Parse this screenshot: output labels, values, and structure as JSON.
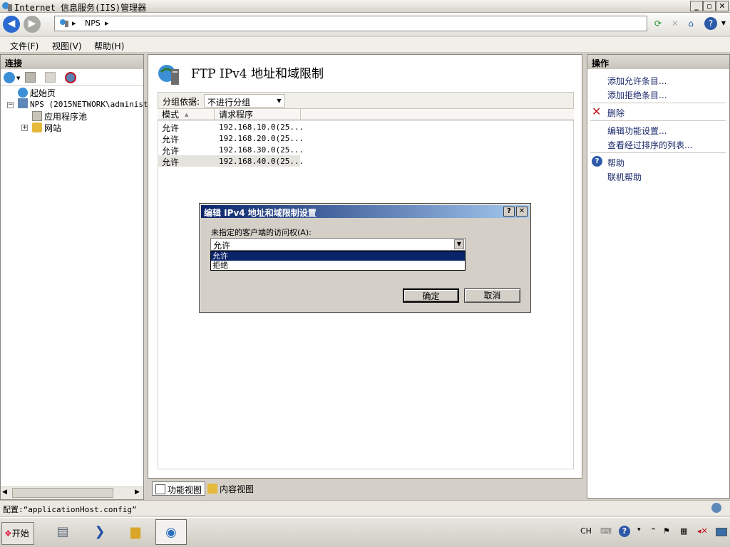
{
  "window": {
    "title": "Internet 信息服务(IIS)管理器",
    "controls": {
      "minimize": "_",
      "restore": "▫",
      "close": "✕"
    }
  },
  "address": {
    "crumbs": [
      "NPS",
      "▸"
    ],
    "separator": "▸",
    "back_icon": "back-arrow-icon",
    "forward_icon": "forward-arrow-icon"
  },
  "menu": [
    {
      "label": "文件(F)"
    },
    {
      "label": "视图(V)"
    },
    {
      "label": "帮助(H)"
    }
  ],
  "connections": {
    "header": "连接",
    "tree": [
      {
        "label": "起始页",
        "icon": "start-page-icon"
      },
      {
        "label": "NPS (2015NETWORK\\administr",
        "icon": "server-icon",
        "expander": "−"
      },
      {
        "label": "应用程序池",
        "icon": "app-pools-icon"
      },
      {
        "label": "网站",
        "icon": "sites-icon",
        "expander": "+"
      }
    ]
  },
  "main": {
    "title": "FTP IPv4 地址和域限制",
    "group_by_label": "分组依据:",
    "group_by_value": "不进行分组",
    "columns": [
      "模式",
      "请求程序"
    ],
    "rows": [
      {
        "mode": "允许",
        "requester": "192.168.10.0(25..."
      },
      {
        "mode": "允许",
        "requester": "192.168.20.0(25..."
      },
      {
        "mode": "允许",
        "requester": "192.168.30.0(25..."
      },
      {
        "mode": "允许",
        "requester": "192.168.40.0(25..."
      }
    ],
    "view_tabs": [
      "功能视图",
      "内容视图"
    ]
  },
  "actions": {
    "header": "操作",
    "items": [
      {
        "label": "添加允许条目..."
      },
      {
        "label": "添加拒绝条目..."
      },
      {
        "label": "删除"
      },
      {
        "label": "编辑功能设置..."
      },
      {
        "label": "查看经过排序的列表..."
      },
      {
        "label": "帮助"
      },
      {
        "label": "联机帮助"
      }
    ]
  },
  "status": {
    "text": "配置:“applicationHost.config”"
  },
  "dialog": {
    "title": "编辑 IPv4 地址和域限制设置",
    "help_btn": "?",
    "close_btn": "✕",
    "label": "未指定的客户端的访问权(A):",
    "selected": "允许",
    "options": [
      "允许",
      "拒绝"
    ],
    "ok": "确定",
    "cancel": "取消"
  },
  "taskbar": {
    "start_label": "开始",
    "lang": "CH"
  },
  "colors": {
    "accent": "#0a246a",
    "link": "#1a2a6c",
    "delete_red": "#c0151d"
  }
}
